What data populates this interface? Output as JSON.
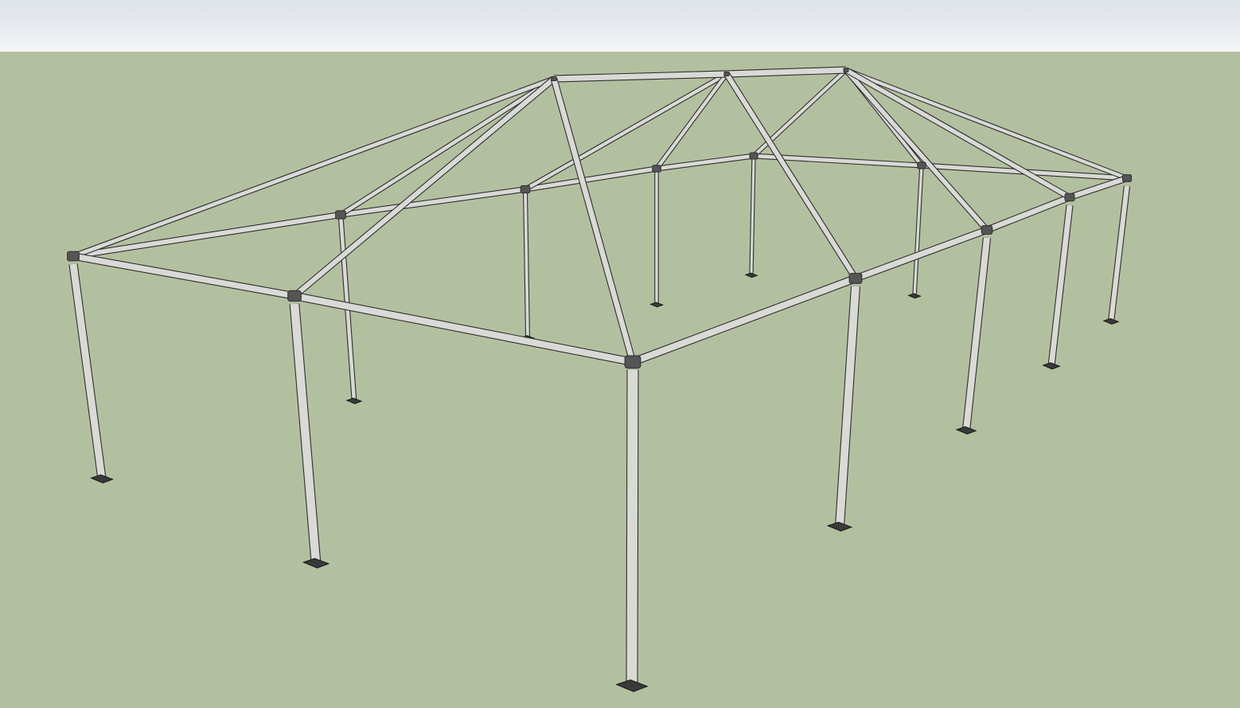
{
  "scene": {
    "sky_colors": [
      "#dde3ea",
      "#e9ecf0",
      "#f4f6f8"
    ],
    "ground_color": "#b3c09f",
    "pipe_color": "#d9d9d6",
    "pipe_outline": "#2e2e2e",
    "fitting_color": "#555555",
    "baseplate_color": "#3a3a3a"
  }
}
